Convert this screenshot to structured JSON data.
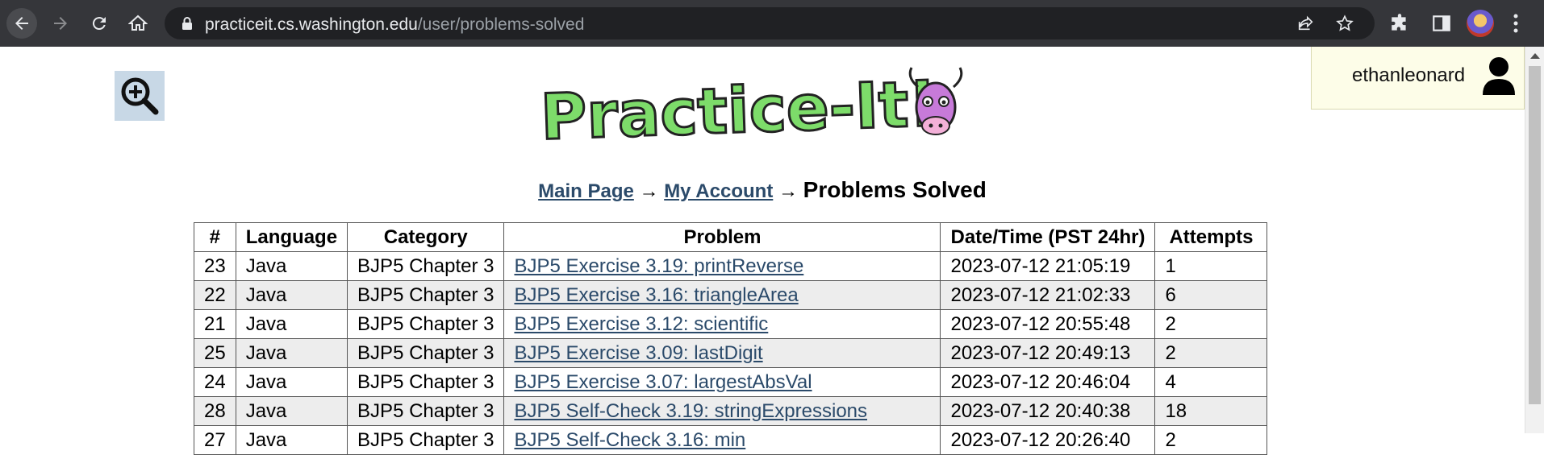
{
  "browser": {
    "url_host": "practiceit.cs.washington.edu",
    "url_path": "/user/problems-solved"
  },
  "user": {
    "name": "ethanleonard"
  },
  "breadcrumb": {
    "main": "Main Page",
    "arrow": "→",
    "account": "My Account",
    "current": "Problems Solved"
  },
  "table": {
    "headers": [
      "#",
      "Language",
      "Category",
      "Problem",
      "Date/Time (PST 24hr)",
      "Attempts"
    ],
    "rows": [
      {
        "num": "23",
        "language": "Java",
        "category": "BJP5 Chapter 3",
        "problem": "BJP5 Exercise 3.19: printReverse",
        "datetime": "2023-07-12 21:05:19",
        "attempts": "1"
      },
      {
        "num": "22",
        "language": "Java",
        "category": "BJP5 Chapter 3",
        "problem": "BJP5 Exercise 3.16: triangleArea",
        "datetime": "2023-07-12 21:02:33",
        "attempts": "6"
      },
      {
        "num": "21",
        "language": "Java",
        "category": "BJP5 Chapter 3",
        "problem": "BJP5 Exercise 3.12: scientific",
        "datetime": "2023-07-12 20:55:48",
        "attempts": "2"
      },
      {
        "num": "25",
        "language": "Java",
        "category": "BJP5 Chapter 3",
        "problem": "BJP5 Exercise 3.09: lastDigit",
        "datetime": "2023-07-12 20:49:13",
        "attempts": "2"
      },
      {
        "num": "24",
        "language": "Java",
        "category": "BJP5 Chapter 3",
        "problem": "BJP5 Exercise 3.07: largestAbsVal",
        "datetime": "2023-07-12 20:46:04",
        "attempts": "4"
      },
      {
        "num": "28",
        "language": "Java",
        "category": "BJP5 Chapter 3",
        "problem": "BJP5 Self-Check 3.19: stringExpressions",
        "datetime": "2023-07-12 20:40:38",
        "attempts": "18"
      },
      {
        "num": "27",
        "language": "Java",
        "category": "BJP5 Chapter 3",
        "problem": "BJP5 Self-Check 3.16: min",
        "datetime": "2023-07-12 20:26:40",
        "attempts": "2"
      }
    ]
  },
  "colors": {
    "chrome_bg": "#35363a",
    "link": "#2b4a6a",
    "alt_row": "#ededed",
    "user_box": "#fdfde8"
  },
  "icons": {
    "back": "arrow-left-icon",
    "forward": "arrow-right-icon",
    "reload": "reload-icon",
    "home": "home-icon",
    "lock": "lock-icon",
    "share": "share-icon",
    "star": "star-icon",
    "extensions": "puzzle-icon",
    "sidepanel": "side-panel-icon",
    "menu": "kebab-menu-icon",
    "zoom": "zoom-in-icon",
    "user": "user-icon"
  }
}
